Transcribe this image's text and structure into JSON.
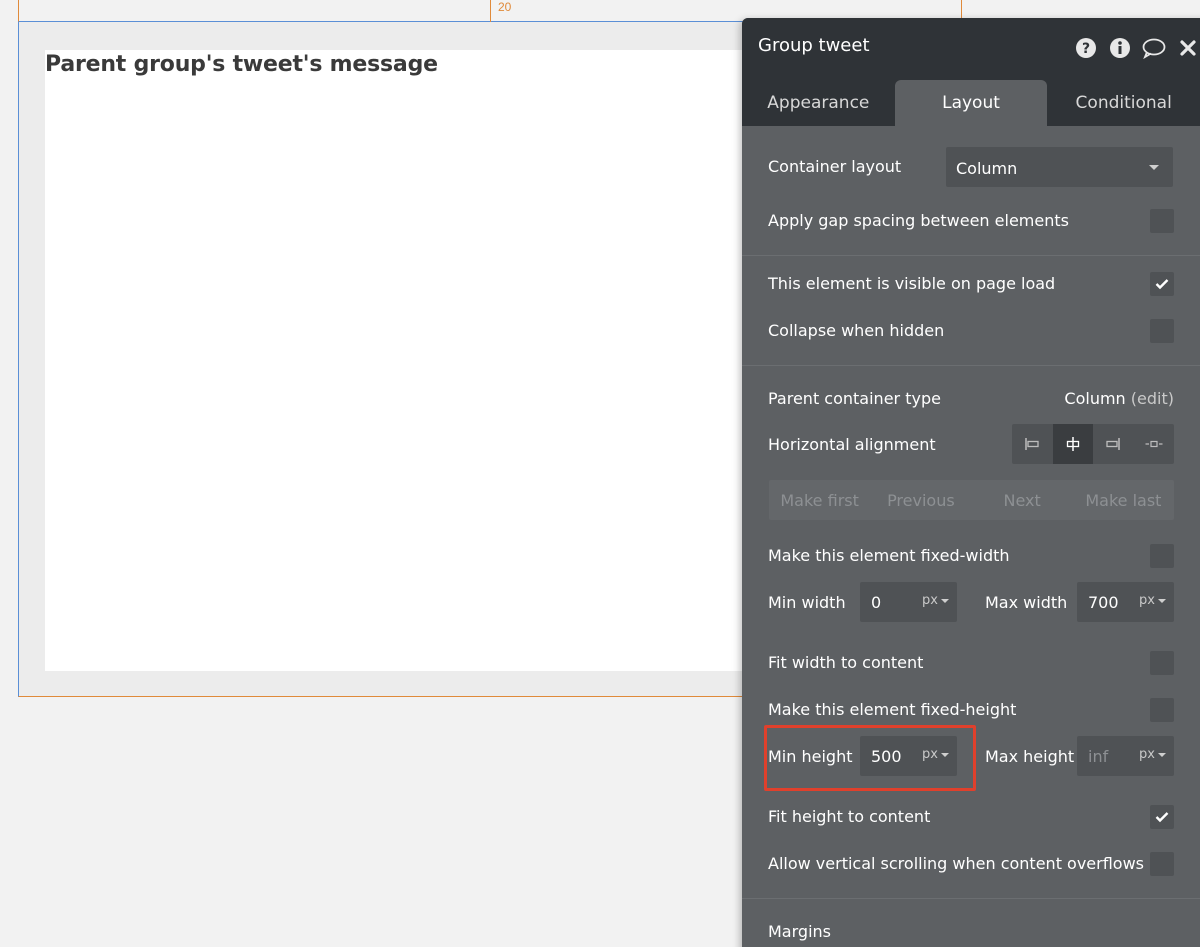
{
  "canvas": {
    "ruler_label": "20",
    "group_text": "Parent group's tweet's message"
  },
  "panel": {
    "title": "Group tweet",
    "header_icons": [
      "help-icon",
      "info-icon",
      "comment-icon",
      "close-icon"
    ],
    "tabs": [
      {
        "label": "Appearance",
        "active": false
      },
      {
        "label": "Layout",
        "active": true
      },
      {
        "label": "Conditional",
        "active": false
      }
    ],
    "container_layout": {
      "label": "Container layout",
      "value": "Column"
    },
    "gap_spacing": {
      "label": "Apply gap spacing between elements",
      "checked": false
    },
    "visible_on_load": {
      "label": "This element is visible on page load",
      "checked": true
    },
    "collapse_hidden": {
      "label": "Collapse when hidden",
      "checked": false
    },
    "parent_container": {
      "label": "Parent container type",
      "value": "Column",
      "edit": "(edit)"
    },
    "horizontal_alignment": {
      "label": "Horizontal alignment",
      "options": [
        "left",
        "center",
        "right",
        "stretch"
      ],
      "selected": "center"
    },
    "order_buttons": [
      "Make first",
      "Previous",
      "Next",
      "Make last"
    ],
    "fixed_width": {
      "label": "Make this element fixed-width",
      "checked": false
    },
    "min_width": {
      "label": "Min width",
      "value": "0",
      "unit": "px"
    },
    "max_width": {
      "label": "Max width",
      "value": "700",
      "unit": "px"
    },
    "fit_width": {
      "label": "Fit width to content",
      "checked": false
    },
    "fixed_height": {
      "label": "Make this element fixed-height",
      "checked": false
    },
    "min_height": {
      "label": "Min height",
      "value": "500",
      "unit": "px"
    },
    "max_height": {
      "label": "Max height",
      "placeholder": "inf",
      "unit": "px"
    },
    "fit_height": {
      "label": "Fit height to content",
      "checked": true
    },
    "vertical_scroll": {
      "label": "Allow vertical scrolling when content overflows",
      "checked": false
    },
    "margins": {
      "label": "Margins"
    }
  },
  "colors": {
    "panel_bg": "#5d6063",
    "header_bg": "#2f3337",
    "highlight": "#e0402c",
    "ruler": "#e08a3a"
  }
}
